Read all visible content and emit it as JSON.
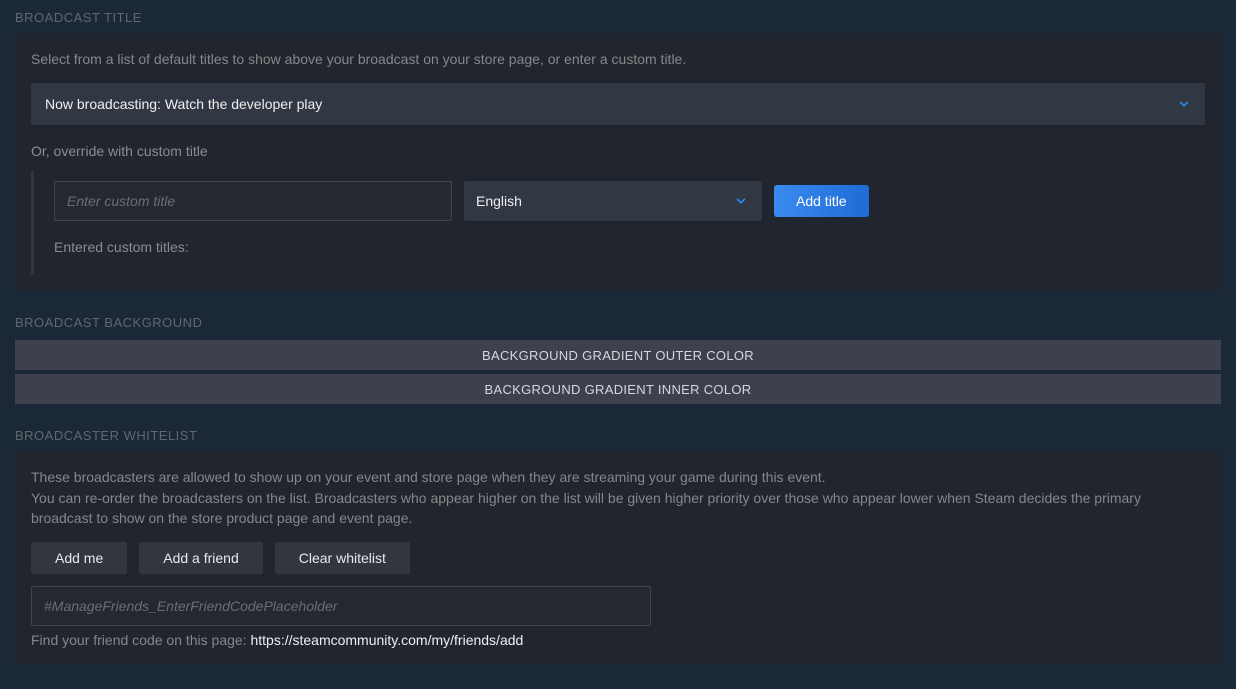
{
  "broadcast_title": {
    "header": "BROADCAST TITLE",
    "description": "Select from a list of default titles to show above your broadcast on your store page, or enter a custom title.",
    "selected_default": "Now broadcasting: Watch the developer play",
    "override_label": "Or, override with custom title",
    "custom_placeholder": "Enter custom title",
    "language_selected": "English",
    "add_title_label": "Add title",
    "entered_custom_label": "Entered custom titles:"
  },
  "broadcast_background": {
    "header": "BROADCAST BACKGROUND",
    "outer_label": "BACKGROUND GRADIENT OUTER COLOR",
    "inner_label": "BACKGROUND GRADIENT INNER COLOR"
  },
  "broadcaster_whitelist": {
    "header": "BROADCASTER WHITELIST",
    "description_line1": "These broadcasters are allowed to show up on your event and store page when they are streaming your game during this event.",
    "description_line2": "You can re-order the broadcasters on the list. Broadcasters who appear higher on the list will be given higher priority over those who appear lower when Steam decides the primary broadcast to show on the store product page and event page.",
    "add_me_label": "Add me",
    "add_friend_label": "Add a friend",
    "clear_label": "Clear whitelist",
    "friend_code_placeholder": "#ManageFriends_EnterFriendCodePlaceholder",
    "find_code_prefix": "Find your friend code on this page: ",
    "find_code_link": "https://steamcommunity.com/my/friends/add"
  }
}
